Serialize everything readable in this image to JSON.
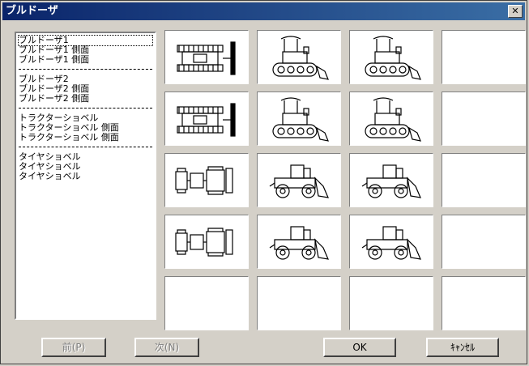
{
  "window": {
    "title": "ブルドーザ",
    "close_label": "✕"
  },
  "list": {
    "groups": [
      {
        "items": [
          {
            "label": "ブルドーザ1"
          },
          {
            "label": "ブルドーザ1 側面"
          },
          {
            "label": "ブルドーザ1 側面"
          }
        ]
      },
      {
        "items": [
          {
            "label": "ブルドーザ2"
          },
          {
            "label": "ブルドーザ2 側面"
          },
          {
            "label": "ブルドーザ2 側面"
          }
        ]
      },
      {
        "items": [
          {
            "label": "トラクターショベル"
          },
          {
            "label": "トラクターショベル 側面"
          },
          {
            "label": "トラクターショベル 側面"
          }
        ]
      },
      {
        "items": [
          {
            "label": "タイヤショベル"
          },
          {
            "label": "タイヤショベル"
          },
          {
            "label": "タイヤショベル"
          }
        ]
      }
    ],
    "selected_index": 0
  },
  "gallery": {
    "rows": [
      [
        "bulldozer-top-view-icon",
        "bulldozer-side-view-icon",
        "bulldozer-side-view-icon",
        ""
      ],
      [
        "bulldozer-top-view-icon",
        "bulldozer-side-view-icon",
        "bulldozer-side-view-icon",
        ""
      ],
      [
        "loader-top-view-icon",
        "wheel-loader-side-view-icon",
        "wheel-loader-side-view-icon",
        ""
      ],
      [
        "loader-top-view-icon",
        "wheel-loader-side-view-icon",
        "wheel-loader-side-view-icon",
        ""
      ],
      [
        "",
        "",
        "",
        ""
      ]
    ]
  },
  "buttons": {
    "prev_label": "前(P)",
    "next_label": "次(N)",
    "ok_label": "OK",
    "cancel_label": "ｷｬﾝｾﾙ"
  }
}
